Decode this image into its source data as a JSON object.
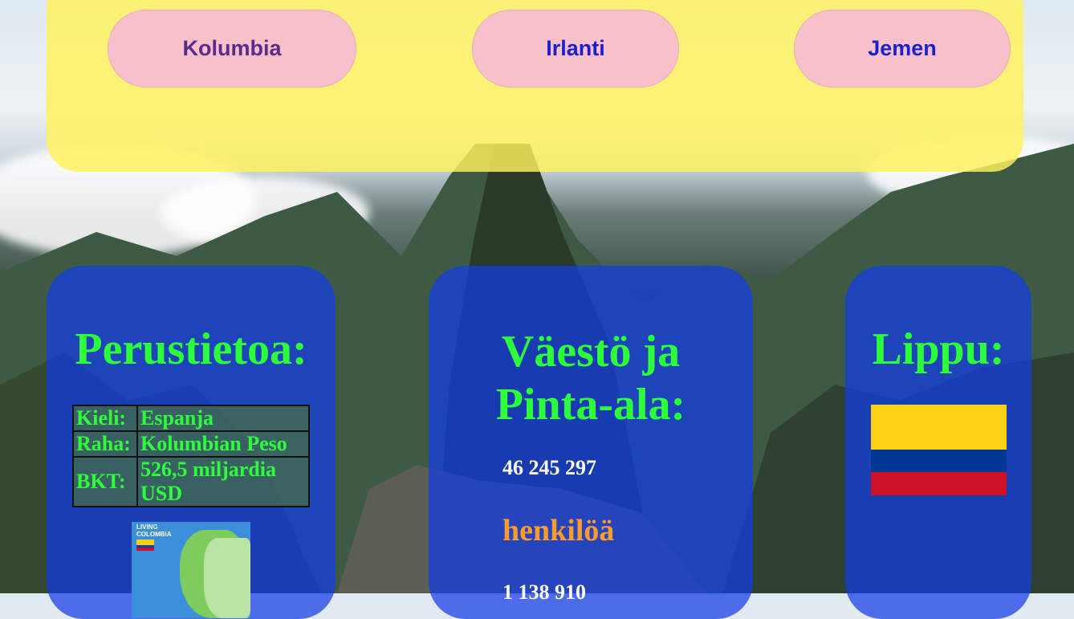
{
  "nav": {
    "items": [
      {
        "label": "Kolumbia"
      },
      {
        "label": "Irlanti"
      },
      {
        "label": "Jemen"
      }
    ]
  },
  "basics": {
    "title": "Perustietoa:",
    "rows": [
      {
        "key": "Kieli:",
        "value": "Espanja"
      },
      {
        "key": "Raha:",
        "value": "Kolumbian Peso"
      },
      {
        "key": "BKT:",
        "value": "526,5 miljardia USD"
      }
    ],
    "map_image": {
      "header_line1": "LIVING",
      "header_line2": "COLOMBIA"
    }
  },
  "population": {
    "title_line1": "Väestö ja",
    "title_line2": "Pinta-ala:",
    "population_value": "46 245 297",
    "population_unit": "henkilöä",
    "area_value": "1 138 910"
  },
  "flag": {
    "title": "Lippu:",
    "colors": {
      "yellow": "#fcd116",
      "blue": "#003893",
      "red": "#ce1126"
    }
  },
  "theme": {
    "nav_panel": "#fff35a",
    "nav_button": "#f8c0c8",
    "card_bg": "#123ce6",
    "heading_green": "#2dff3a",
    "accent_orange": "#ff9a2c"
  }
}
